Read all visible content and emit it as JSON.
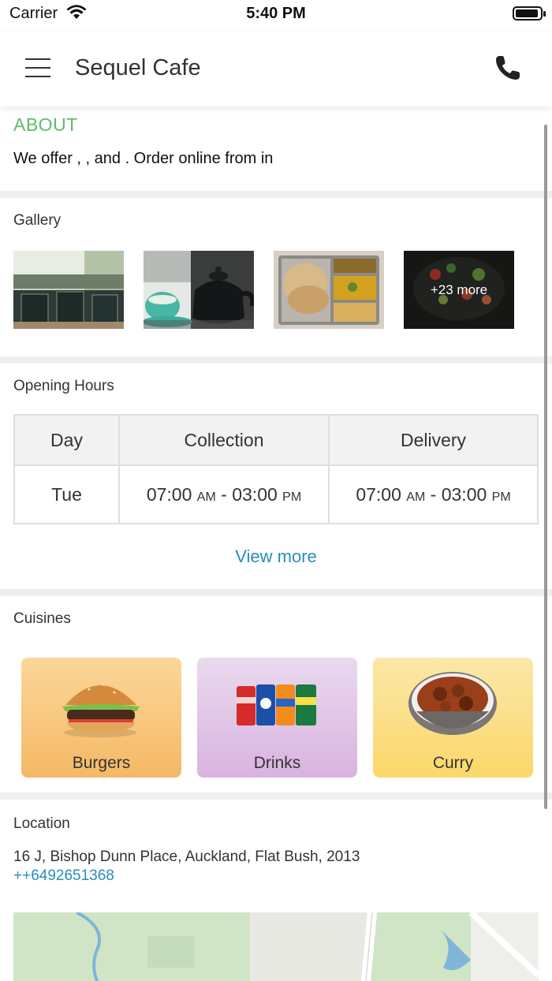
{
  "status_bar": {
    "carrier": "Carrier",
    "time": "5:40 PM"
  },
  "header": {
    "title": "Sequel Cafe"
  },
  "about": {
    "heading": "ABOUT",
    "text": "We offer , ,  and . Order online from  in"
  },
  "gallery": {
    "title": "Gallery",
    "more_label": "+23 more"
  },
  "opening_hours": {
    "title": "Opening Hours",
    "columns": [
      "Day",
      "Collection",
      "Delivery"
    ],
    "rows": [
      {
        "day": "Tue",
        "collection_start": "07:00",
        "collection_start_ampm": "AM",
        "collection_end": "03:00",
        "collection_end_ampm": "PM",
        "delivery_start": "07:00",
        "delivery_start_ampm": "AM",
        "delivery_end": "03:00",
        "delivery_end_ampm": "PM"
      }
    ],
    "view_more": "View more"
  },
  "cuisines": {
    "title": "Cuisines",
    "items": [
      {
        "label": "Burgers"
      },
      {
        "label": "Drinks"
      },
      {
        "label": "Curry"
      }
    ]
  },
  "location": {
    "title": "Location",
    "address": "16 J, Bishop Dunn Place, Auckland, Flat Bush, 2013",
    "phone": "++6492651368"
  },
  "colors": {
    "accent_green": "#5cbd6a",
    "link_blue": "#2a8fb8"
  }
}
